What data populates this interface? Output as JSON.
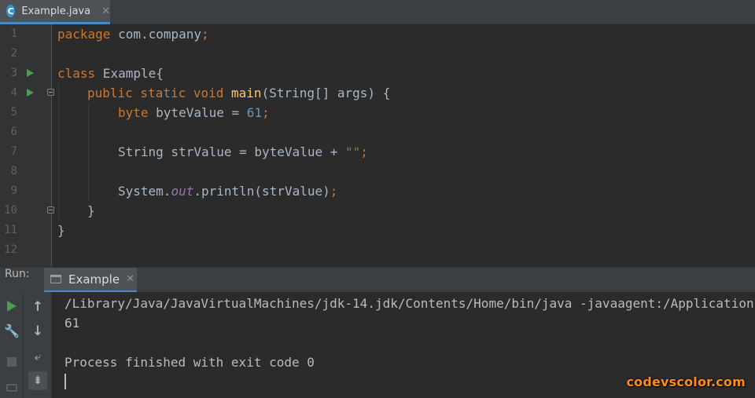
{
  "editor_tab": {
    "icon_letter": "C",
    "label": "Example.java",
    "close": "✕"
  },
  "editor": {
    "lines": [
      {
        "num": "1"
      },
      {
        "num": "2"
      },
      {
        "num": "3"
      },
      {
        "num": "4"
      },
      {
        "num": "5"
      },
      {
        "num": "6"
      },
      {
        "num": "7"
      },
      {
        "num": "8"
      },
      {
        "num": "9"
      },
      {
        "num": "10"
      },
      {
        "num": "11"
      },
      {
        "num": "12"
      }
    ],
    "code": {
      "l1_kw": "package",
      "l1_rest": " com.company",
      "l1_semi": ";",
      "l3_kw": "class",
      "l3_rest": " Example{",
      "l4_kw": "public static void",
      "l4_fn": "main",
      "l4_rest": "(String[] args) {",
      "l5_kw": "byte",
      "l5_rest": " byteValue = ",
      "l5_num": "61",
      "l5_semi": ";",
      "l7_rest": "String strValue = byteValue + ",
      "l7_str": "\"\"",
      "l7_semi": ";",
      "l9_a": "System.",
      "l9_field": "out",
      "l9_b": ".println(strValue)",
      "l9_semi": ";",
      "l10": "}",
      "l11": "}"
    }
  },
  "run_panel": {
    "title": "Run:",
    "tab_label": "Example",
    "tab_close": "✕",
    "console_lines": [
      "/Library/Java/JavaVirtualMachines/jdk-14.jdk/Contents/Home/bin/java -javaagent:/Applications/",
      "61",
      "",
      "Process finished with exit code 0"
    ],
    "icons": {
      "rerun": "rerun-icon",
      "settings": "wrench-icon",
      "stop": "stop-icon",
      "dump": "camera-icon",
      "up": "↑",
      "down": "↓",
      "wrap": "⤶",
      "scroll": "⇟"
    }
  },
  "watermark": "codevscolor.com",
  "colors": {
    "keyword": "#cc7832",
    "function": "#ffc66d",
    "number": "#6897bb",
    "string": "#6a8759",
    "field": "#9876aa",
    "run_green": "#499c54",
    "accent": "#4a88c7"
  }
}
